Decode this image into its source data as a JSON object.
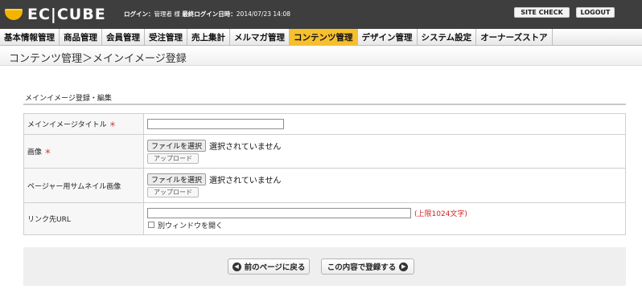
{
  "header": {
    "logo_text": "EC|CUBE",
    "login_label": "ログイン：",
    "login_user": "管理者 様",
    "last_login_label": "最終ログイン日時：",
    "last_login_value": "2014/07/23 14:08",
    "site_check_label": "SITE CHECK",
    "logout_label": "LOGOUT"
  },
  "nav": {
    "items": [
      {
        "label": "基本情報管理"
      },
      {
        "label": "商品管理"
      },
      {
        "label": "会員管理"
      },
      {
        "label": "受注管理"
      },
      {
        "label": "売上集計"
      },
      {
        "label": "メルマガ管理"
      },
      {
        "label": "コンテンツ管理"
      },
      {
        "label": "デザイン管理"
      },
      {
        "label": "システム設定"
      },
      {
        "label": "オーナーズストア"
      }
    ],
    "active_index": 6
  },
  "page": {
    "title": "コンテンツ管理＞メインイメージ登録",
    "section_title": "メインイメージ登録・編集"
  },
  "form": {
    "required_mark": "＊",
    "title_label": "メインイメージタイトル",
    "title_value": "",
    "image_label": "画像",
    "file_button": "ファイルを選択",
    "no_file_selected": "選択されていません",
    "upload_button": "アップロード",
    "thumb_label": "ページャー用サムネイル画像",
    "url_label": "リンク先URL",
    "url_value": "",
    "url_limit_note": "(上限1024文字)",
    "new_window_label": "別ウィンドウを開く",
    "new_window_checked": false
  },
  "actions": {
    "back_label": "前のページに戻る",
    "submit_label": "この内容で登録する"
  },
  "colors": {
    "header_bg": "#3e3e3e",
    "active_tab": "#f6bf2e",
    "required": "#d12020"
  }
}
